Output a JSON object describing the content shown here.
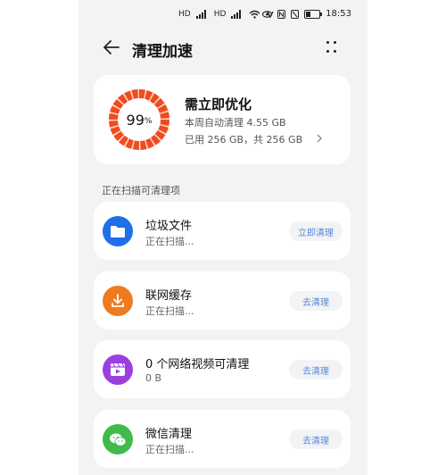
{
  "status_bar": {
    "left_icons": [
      "HD",
      "HD"
    ],
    "signal_labels": [
      "⁴ᴳ",
      "⁴ᴳ"
    ],
    "time": "18:53"
  },
  "header": {
    "title": "清理加速"
  },
  "summary": {
    "percent": "99",
    "percent_sign": "%",
    "progress_fraction": 0.99,
    "title": "需立即优化",
    "line1": "本周自动清理 4.55 GB",
    "line2": "已用 256 GB，共 256 GB"
  },
  "section_label": "正在扫描可清理项",
  "items": [
    {
      "title": "垃圾文件",
      "subtitle": "正在扫描...",
      "button": "立即清理",
      "icon": "folder-icon",
      "color": "#1f6fe8"
    },
    {
      "title": "联网缓存",
      "subtitle": "正在扫描...",
      "button": "去清理",
      "icon": "download-icon",
      "color": "#ee7b20"
    },
    {
      "title": "0 个网络视频可清理",
      "subtitle": "0 B",
      "button": "去清理",
      "icon": "video-icon",
      "color": "#9b3fe0"
    },
    {
      "title": "微信清理",
      "subtitle": "正在扫描...",
      "button": "去清理",
      "icon": "wechat-icon",
      "color": "#3fba4b"
    }
  ],
  "colors": {
    "ring_progress": "#f04b1e",
    "ring_track": "#fbd8c9",
    "accent_button_text": "#5b88d6"
  }
}
